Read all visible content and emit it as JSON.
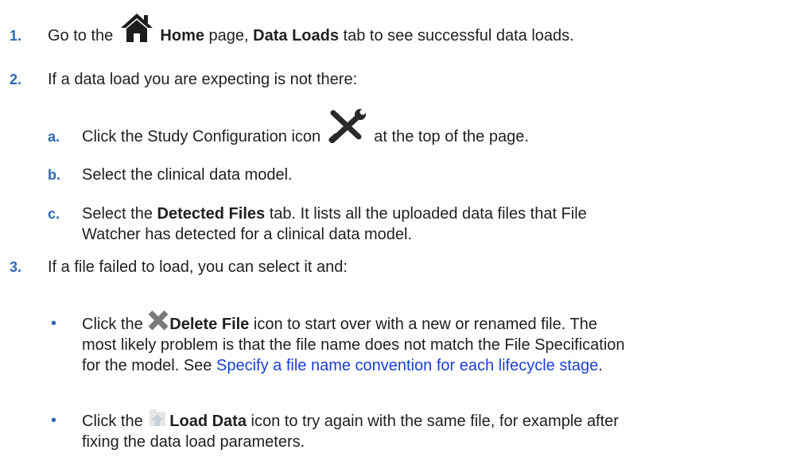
{
  "step1": {
    "marker": "1.",
    "pre": "Go to the",
    "icon": "home-icon",
    "bold1": "Home",
    "mid": "page,",
    "bold2": "Data Loads",
    "post": "tab to see successful data loads."
  },
  "step2": {
    "marker": "2.",
    "text": "If a data load you are expecting is not there:",
    "sub": [
      {
        "marker": "a.",
        "pre": "Click the Study Configuration icon",
        "icon": "study-configuration-icon",
        "post": "at the top of the page."
      },
      {
        "marker": "b.",
        "text": "Select the clinical data model."
      },
      {
        "marker": "c.",
        "pre": "Select the",
        "bold": "Detected Files",
        "post": "tab. It lists all the uploaded data files that File",
        "line2": "Watcher has detected for a clinical data model."
      }
    ]
  },
  "step3": {
    "marker": "3.",
    "text": "If a file failed to load, you can select it and:",
    "bullets": [
      {
        "marker": "•",
        "pre": "Click the",
        "icon": "delete-file-icon",
        "bold": "Delete File",
        "post": "icon to start over with a new or renamed file. The",
        "line2": "most likely problem is that the file name does not match the File Specification",
        "line3_pre": "for the model. See",
        "link": "Specify a file name convention for each lifecycle stage",
        "line3_post": "."
      },
      {
        "marker": "•",
        "pre": "Click the",
        "icon": "load-data-icon",
        "bold": "Load Data",
        "post": "icon to try again with the same file, for example after",
        "line2": "fixing the data load parameters."
      }
    ]
  },
  "colors": {
    "marker": "#2d6ab3",
    "link": "#1a3fd6",
    "text": "#1f1f1f"
  }
}
